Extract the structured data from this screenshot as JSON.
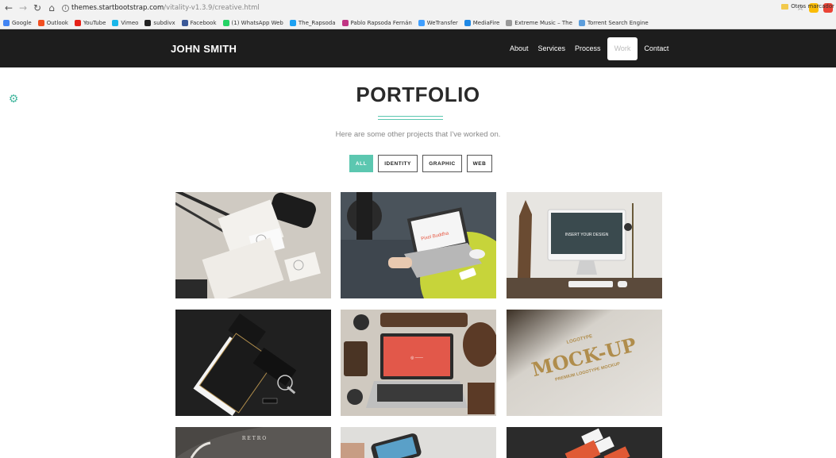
{
  "browser": {
    "url_host": "themes.startbootstrap.com",
    "url_path": "/vitality-v1.3.9/creative.html",
    "bookmarks": [
      {
        "label": "Google",
        "color": "#4285f4"
      },
      {
        "label": "Outlook",
        "color": "#f25022"
      },
      {
        "label": "YouTube",
        "color": "#e62117"
      },
      {
        "label": "Vimeo",
        "color": "#1ab7ea"
      },
      {
        "label": "subdivx",
        "color": "#222222"
      },
      {
        "label": "Facebook",
        "color": "#3b5998"
      },
      {
        "label": "(1) WhatsApp Web",
        "color": "#25d366"
      },
      {
        "label": "The_Rapsoda",
        "color": "#1da1f2"
      },
      {
        "label": "Pablo Rapsoda Fernán",
        "color": "#c13584"
      },
      {
        "label": "WeTransfer",
        "color": "#409fff"
      },
      {
        "label": "MediaFire",
        "color": "#1e88e5"
      },
      {
        "label": "Extreme Music – The",
        "color": "#999999"
      },
      {
        "label": "Torrent Search Engine",
        "color": "#5c9ddb"
      }
    ],
    "other_bookmarks": "Otros marcador"
  },
  "nav": {
    "brand": "JOHN SMITH",
    "items": [
      {
        "label": "About",
        "active": false
      },
      {
        "label": "Services",
        "active": false
      },
      {
        "label": "Process",
        "active": false
      },
      {
        "label": "Work",
        "active": true
      },
      {
        "label": "Contact",
        "active": false
      }
    ]
  },
  "portfolio": {
    "title": "PORTFOLIO",
    "subtitle": "Here are some other projects that I've worked on.",
    "filters": [
      {
        "label": "ALL",
        "active": true
      },
      {
        "label": "IDENTITY",
        "active": false
      },
      {
        "label": "GRAPHIC",
        "active": false
      },
      {
        "label": "WEB",
        "active": false
      }
    ],
    "tile_texts": {
      "laptop_screen": "Pixel Buddha",
      "imac_screen": "INSERT YOUR DESIGN",
      "mockup_top": "LOGOTYPE",
      "mockup_main": "MOCK-UP",
      "mockup_sub": "PREMIUM LOGOTYPE MOCKUP",
      "retro": "RETRO"
    }
  },
  "colors": {
    "accent": "#5cc7b0",
    "nav_bg": "#1d1d1d"
  }
}
